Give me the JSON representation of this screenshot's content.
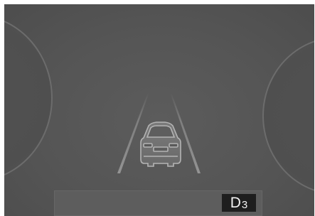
{
  "display": {
    "gear": {
      "letter": "D",
      "number": "3"
    }
  },
  "icons": {
    "vehicle": "car-rear-view-icon",
    "lanes": "lane-lines-icon"
  },
  "colors": {
    "background": "#555555",
    "gauge_outline": "#6c6c6c",
    "gear_box": "#1e1e1e",
    "gear_text": "#f2f2f2"
  }
}
